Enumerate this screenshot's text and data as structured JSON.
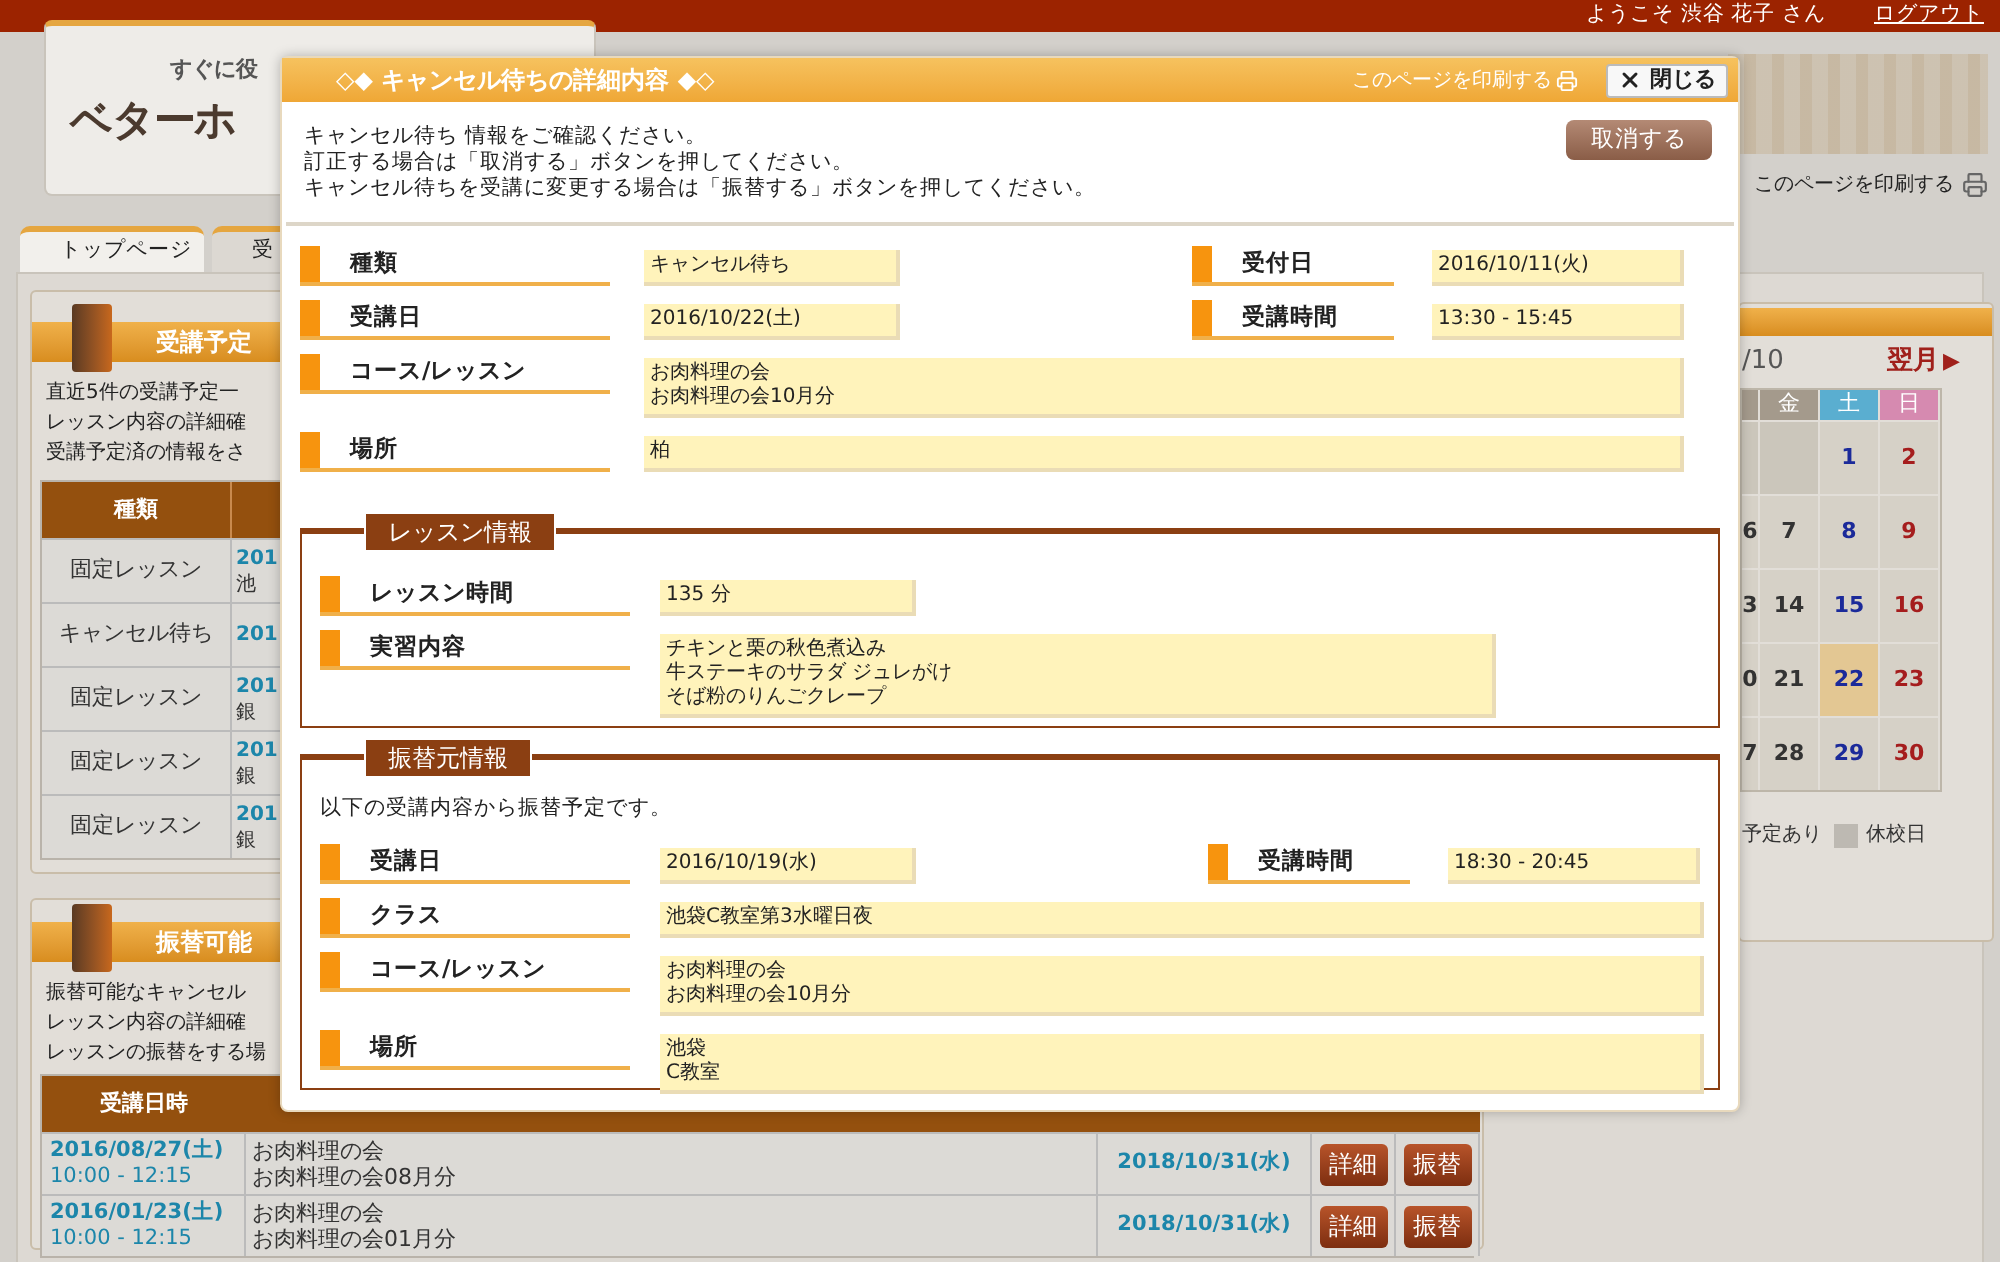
{
  "header": {
    "welcome": "ようこそ 渋谷 花子 さん",
    "logout": "ログアウト",
    "logo_tagline": "すぐに役",
    "logo_text": "ベターホ",
    "print_link": "このページを印刷する"
  },
  "tabs": [
    {
      "label": "トップページ",
      "selected": true
    },
    {
      "label": "受",
      "selected": false
    }
  ],
  "schedule_panel": {
    "title": "受講予定",
    "lines": [
      "直近5件の受講予定一",
      "レッスン内容の詳細確",
      "受講予定済の情報をさ"
    ],
    "columns": [
      "種類"
    ],
    "rows": [
      {
        "type": "固定レッスン",
        "column_2": [
          "201",
          "池"
        ]
      },
      {
        "type": "キャンセル待ち",
        "column_2": [
          "201"
        ]
      },
      {
        "type": "固定レッスン",
        "column_2": [
          "201",
          "銀"
        ]
      },
      {
        "type": "固定レッスン",
        "column_2": [
          "201",
          "銀"
        ]
      },
      {
        "type": "固定レッスン",
        "column_2": [
          "201",
          "銀"
        ]
      }
    ]
  },
  "transfer_panel": {
    "title": "振替可能",
    "lines": [
      "振替可能なキャンセル",
      "レッスン内容の詳細確",
      "レッスンの振替をする場"
    ],
    "columns": [
      "受講日時"
    ],
    "rows": [
      {
        "date": "2016/08/27(土)",
        "time": "10:00 - 12:15",
        "course": [
          "お肉料理の会",
          "お肉料理の会08月分"
        ],
        "deadline": "2018/10/31(水)",
        "buttons": [
          "詳細",
          "振替"
        ]
      },
      {
        "date": "2016/01/23(土)",
        "time": "10:00 - 12:15",
        "course": [
          "お肉料理の会",
          "お肉料理の会01月分"
        ],
        "deadline": "2018/10/31(水)",
        "buttons": [
          "詳細",
          "振替"
        ]
      }
    ]
  },
  "calendar": {
    "month": "/10",
    "next": "翌月",
    "next_icon": "▶",
    "weekdays": [
      {
        "label": "金",
        "color": "#a49a8c"
      },
      {
        "label": "土",
        "color": "#5aaed0"
      },
      {
        "label": "日",
        "color": "#d68ab0"
      }
    ],
    "weeks": [
      [
        {
          "kind": "blank",
          "selected": false
        },
        {
          "kind": "blank",
          "selected": false
        },
        {
          "day": "1",
          "kind": "saturday",
          "selected": false
        },
        {
          "day": "2",
          "kind": "sunday",
          "selected": false
        }
      ],
      [
        {
          "day": "6",
          "kind": "weekday",
          "selected": false
        },
        {
          "day": "7",
          "kind": "weekday",
          "selected": false
        },
        {
          "day": "8",
          "kind": "saturday",
          "selected": false
        },
        {
          "day": "9",
          "kind": "sunday",
          "selected": false
        }
      ],
      [
        {
          "day": "3",
          "kind": "weekday",
          "selected": false
        },
        {
          "day": "14",
          "kind": "weekday",
          "selected": false
        },
        {
          "day": "15",
          "kind": "saturday",
          "selected": false
        },
        {
          "day": "16",
          "kind": "sunday",
          "selected": false
        }
      ],
      [
        {
          "day": "0",
          "kind": "weekday",
          "selected": false
        },
        {
          "day": "21",
          "kind": "weekday",
          "selected": false
        },
        {
          "day": "22",
          "kind": "saturday",
          "selected": true
        },
        {
          "day": "23",
          "kind": "sunday",
          "selected": false
        }
      ],
      [
        {
          "day": "7",
          "kind": "weekday",
          "selected": false
        },
        {
          "day": "28",
          "kind": "weekday",
          "selected": false
        },
        {
          "day": "29",
          "kind": "saturday",
          "selected": false
        },
        {
          "day": "30",
          "kind": "sunday",
          "selected": false
        }
      ]
    ],
    "legend": [
      {
        "label": "予定あり"
      },
      {
        "label": "休校日",
        "color": "#bdb9b2"
      }
    ]
  },
  "dialog": {
    "title": "◇◆ キャンセル待ちの詳細内容 ◆◇",
    "print_link": "このページを印刷する",
    "close": "閉じる",
    "intro": [
      "キャンセル待ち 情報をご確認ください。",
      "訂正する場合は「取消する」ボタンを押してください。",
      "キャンセル待ちを受講に変更する場合は「振替する」ボタンを押してください。"
    ],
    "cancel_button": "取消する",
    "rows": [
      [
        {
          "label": "種類",
          "value": [
            "キャンセル待ち"
          ]
        },
        {
          "label": "受付日",
          "value": [
            "2016/10/11(火)"
          ]
        }
      ],
      [
        {
          "label": "受講日",
          "value": [
            "2016/10/22(土)"
          ]
        },
        {
          "label": "受講時間",
          "value": [
            "13:30 - 15:45"
          ]
        }
      ],
      [
        {
          "label": "コース/レッスン",
          "value": [
            "お肉料理の会",
            "お肉料理の会10月分"
          ],
          "kind": "full"
        }
      ],
      [
        {
          "label": "場所",
          "value": [
            "柏"
          ],
          "kind": "full"
        }
      ]
    ],
    "sections": [
      {
        "title": "レッスン情報",
        "rows": [
          [
            {
              "label": "レッスン時間",
              "value": [
                "135 分"
              ],
              "kind": "short"
            }
          ],
          [
            {
              "label": "実習内容",
              "value": [
                "チキンと栗の秋色煮込み",
                "牛ステーキのサラダ ジュレがけ",
                "そば粉のりんごクレープ"
              ],
              "kind": "medium"
            }
          ]
        ]
      },
      {
        "title": "振替元情報",
        "note": "以下の受講内容から振替予定です。",
        "rows": [
          [
            {
              "label": "受講日",
              "value": [
                "2016/10/19(水)"
              ]
            },
            {
              "label": "受講時間",
              "value": [
                "18:30 - 20:45"
              ]
            }
          ],
          [
            {
              "label": "クラス",
              "value": [
                "池袋C教室第3水曜日夜"
              ],
              "kind": "full"
            }
          ],
          [
            {
              "label": "コース/レッスン",
              "value": [
                "お肉料理の会",
                "お肉料理の会10月分"
              ],
              "kind": "full"
            }
          ],
          [
            {
              "label": "場所",
              "value": [
                "池袋",
                "C教室"
              ],
              "kind": "full"
            }
          ]
        ]
      }
    ]
  }
}
